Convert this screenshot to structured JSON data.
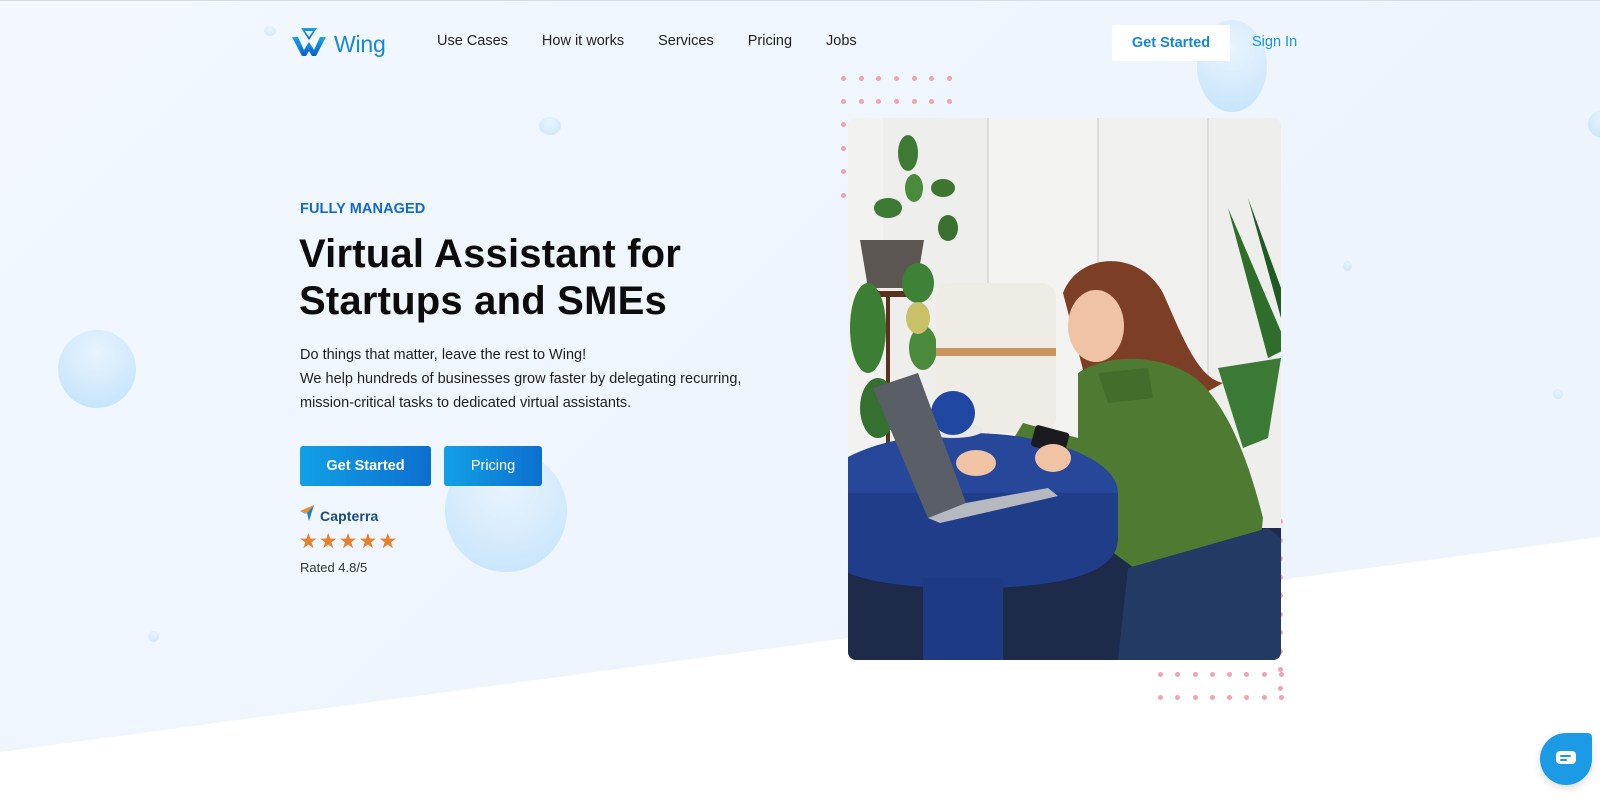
{
  "brand": {
    "name": "Wing",
    "logo_icon": "wing-w-logo-icon",
    "primary_color": "#1488d8",
    "accent_color": "#1169c9"
  },
  "nav": {
    "links": [
      {
        "label": "Use Cases"
      },
      {
        "label": "How it works"
      },
      {
        "label": "Services"
      },
      {
        "label": "Pricing"
      },
      {
        "label": "Jobs"
      }
    ],
    "cta_label": "Get Started",
    "signin_label": "Sign In"
  },
  "hero": {
    "eyebrow": "FULLY MANAGED",
    "title_line1": "Virtual Assistant for",
    "title_line2": "Startups and SMEs",
    "description_line1": "Do things that matter, leave the rest to Wing!",
    "description_line2": "We help hundreds of businesses grow faster by delegating recurring,",
    "description_line3": "mission-critical tasks to dedicated virtual assistants.",
    "primary_button": "Get Started",
    "secondary_button": "Pricing",
    "review": {
      "platform": "Capterra",
      "platform_icon": "capterra-arrow-icon",
      "stars": 5,
      "star_color": "#e6802a",
      "rating_text": "Rated 4.8/5"
    },
    "image_alt": "Woman in green sweater working on laptop at blue table"
  },
  "chat": {
    "icon": "chat-bubble-icon",
    "color": "#1c9ae6"
  }
}
